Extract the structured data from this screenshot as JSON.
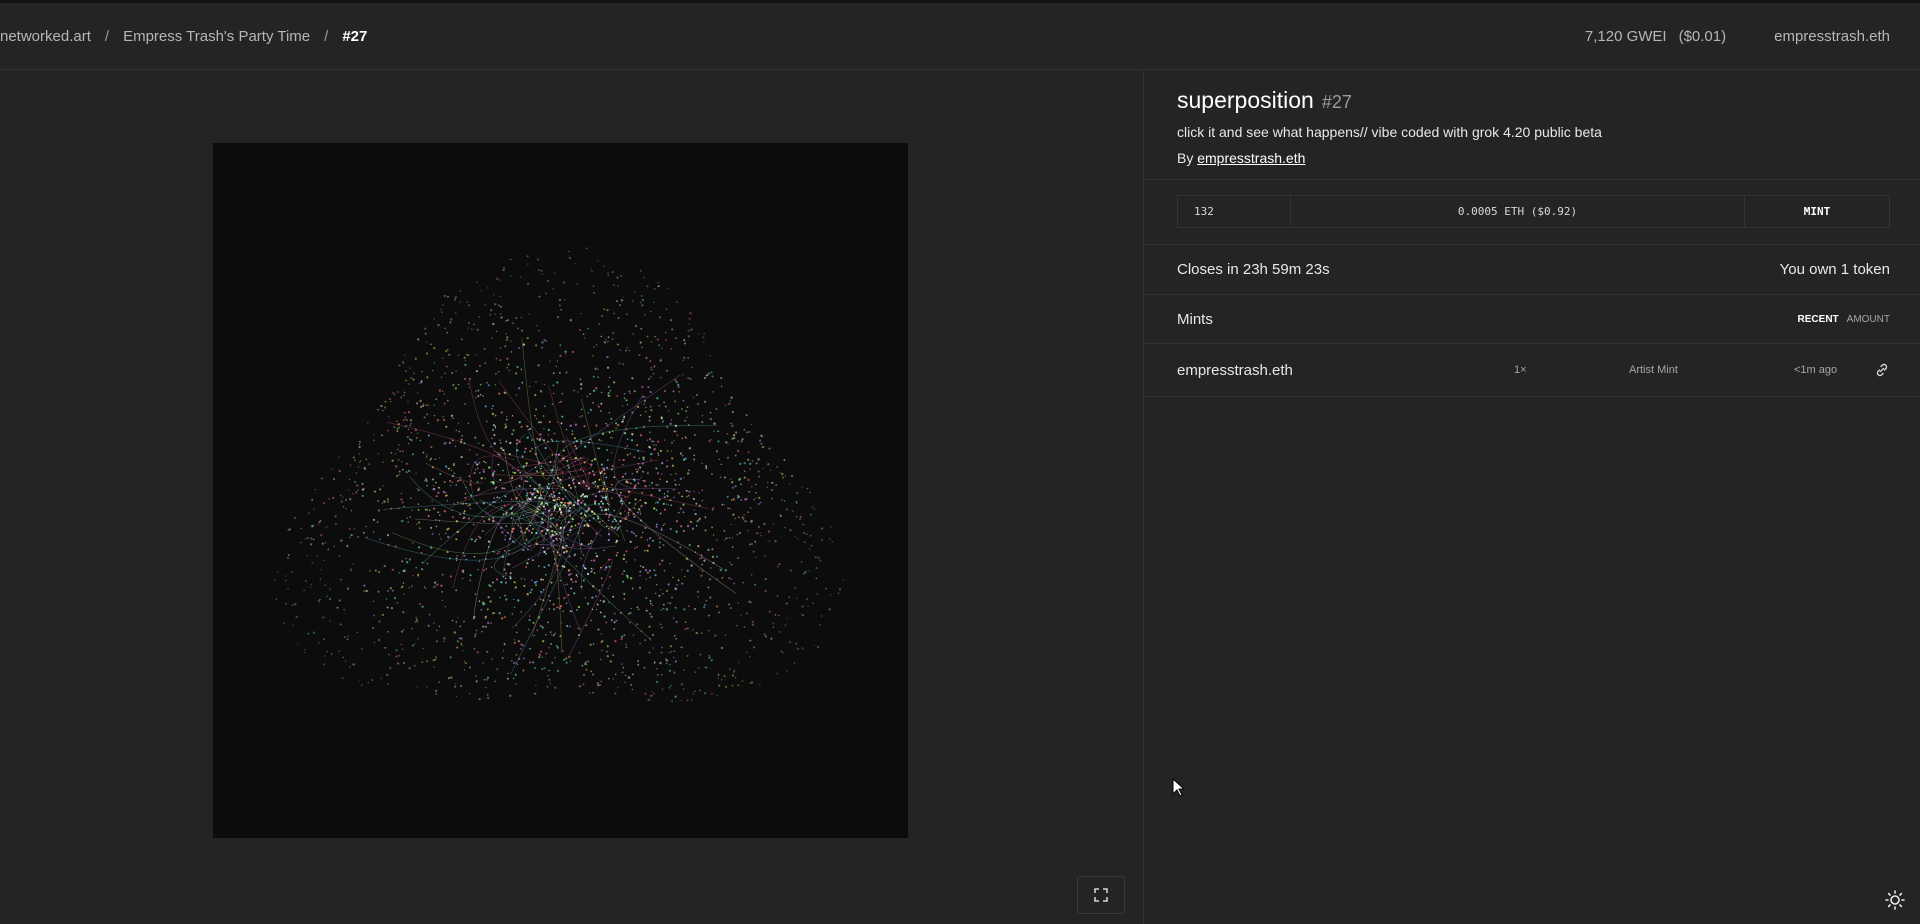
{
  "breadcrumb": {
    "site": "networked.art",
    "collection": "Empress Trash's Party Time",
    "token": "#27",
    "separator": "/"
  },
  "header": {
    "gas": "7,120 GWEI",
    "gas_usd": "($0.01)",
    "account": "empresstrash.eth"
  },
  "artwork": {
    "fullscreen_icon": "expand-icon"
  },
  "token": {
    "title": "superposition",
    "id": "#27",
    "description": "click it and see what happens// vibe coded with grok 4.20 public beta",
    "by_label": "By",
    "artist": "empresstrash.eth"
  },
  "mint": {
    "quantity": "132",
    "price": "0.0005 ETH ($0.92)",
    "button": "MINT"
  },
  "status": {
    "closes": "Closes in 23h 59m 23s",
    "owned": "You own 1 token"
  },
  "mints": {
    "heading": "Mints",
    "sort_recent": "RECENT",
    "sort_amount": "AMOUNT",
    "rows": [
      {
        "minter": "empresstrash.eth",
        "count": "1×",
        "type": "Artist Mint",
        "time": "<1m ago"
      }
    ]
  },
  "colors": {
    "background": "#242426",
    "art_background": "#0c0c0c",
    "border": "#333336"
  }
}
